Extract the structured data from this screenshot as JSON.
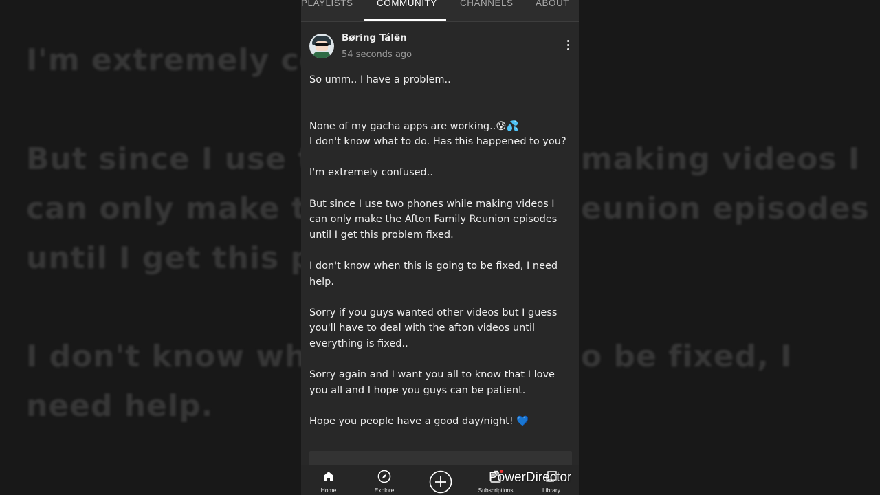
{
  "tabs": [
    {
      "label": "PLAYLISTS"
    },
    {
      "label": "COMMUNITY"
    },
    {
      "label": "CHANNELS"
    },
    {
      "label": "ABOUT"
    }
  ],
  "post": {
    "author": "Børing Tálën",
    "time": "54 seconds ago",
    "paragraphs": [
      "So umm.. I have a problem..",
      "None of my gacha apps are working..😰💦\nI don't know what to do. Has this happened to you?",
      "I'm extremely confused..",
      "But since I use two phones while making videos I can only make the Afton Family Reunion episodes until I get this problem fixed.",
      "I don't know when this is going to be fixed, I need help.",
      "Sorry if you guys wanted other videos but I guess you'll have to deal with the afton videos until everything is fixed..",
      "Sorry again and I want you all to know that I love you all and I hope you guys can be patient.",
      "Hope you people have a good day/night! 💙"
    ]
  },
  "background_text": [
    "I'm extremely co",
    "But since I use t",
    "making videos I",
    "can only make th",
    "eunion episodes",
    "until I get this p",
    "I don't know whe",
    "o be fixed, I",
    "need help."
  ],
  "bottom_nav": [
    {
      "label": "Home",
      "icon": "home-icon"
    },
    {
      "label": "Explore",
      "icon": "compass-icon"
    },
    {
      "label": "",
      "icon": "create-plus-icon"
    },
    {
      "label": "Subscriptions",
      "icon": "subscriptions-icon"
    },
    {
      "label": "Library",
      "icon": "library-icon"
    }
  ],
  "watermark": "PowerDirector",
  "colors": {
    "background": "#1a1a1a",
    "panel": "#282828",
    "text": "#eeeeee",
    "muted": "#9a9a9a",
    "heart": "#4aa3ff"
  }
}
